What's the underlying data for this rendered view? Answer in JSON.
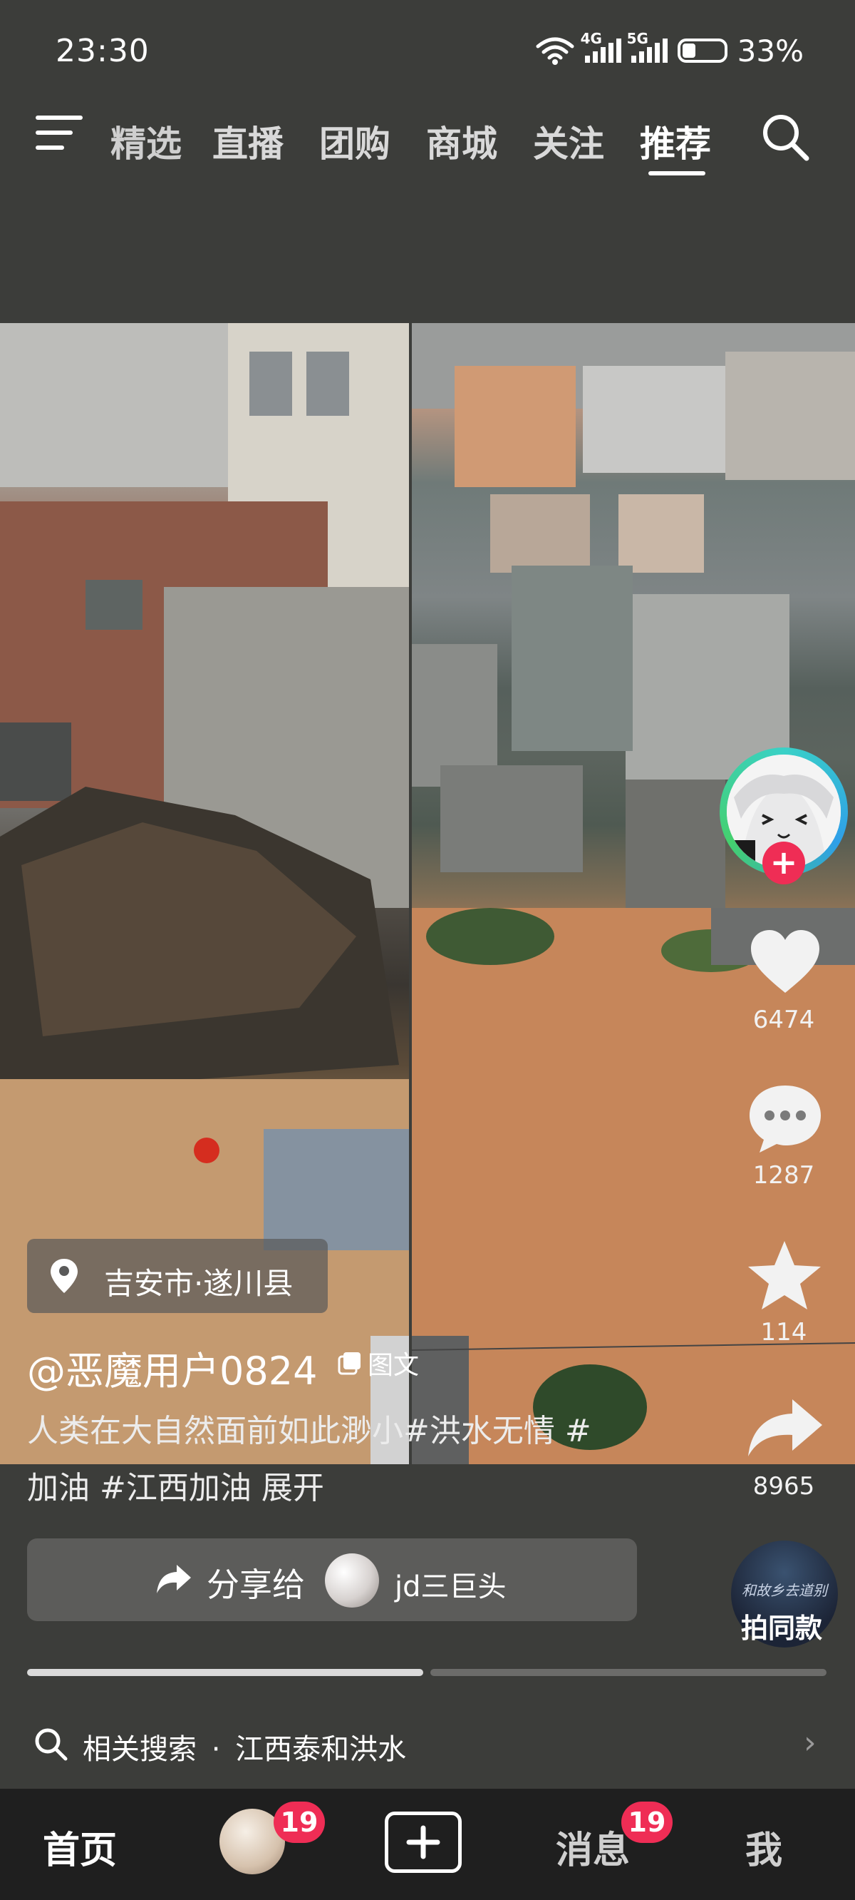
{
  "status": {
    "time": "23:30",
    "network1": "4G",
    "network2": "5G",
    "battery": "33%",
    "battery_level": 0.33
  },
  "top_tabs": [
    {
      "label": "精选"
    },
    {
      "label": "直播"
    },
    {
      "label": "团购"
    },
    {
      "label": "商城"
    },
    {
      "label": "关注"
    },
    {
      "label": "推荐"
    }
  ],
  "active_tab": "推荐",
  "post": {
    "location": "吉安市·遂川县",
    "username": "@恶魔用户0824",
    "type_tag": "图文",
    "caption_line1": "人类在大自然面前如此渺小#洪水无情 #",
    "caption_line2": "加油 #江西加油  展开"
  },
  "rail": {
    "like_count": "6474",
    "comment_count": "1287",
    "favorite_count": "114",
    "share_count": "8965",
    "follow_plus": "+"
  },
  "share_bar": {
    "label": "分享给",
    "recipient": "jd三巨头"
  },
  "same_style": {
    "label": "拍同款",
    "thumb_text": "和故乡去道别"
  },
  "image_progress": {
    "current": 1,
    "total": 2
  },
  "related_search": {
    "prefix": "相关搜索",
    "query": "江西泰和洪水",
    "separator": "·"
  },
  "bottom_nav": {
    "home": "首页",
    "messages": "消息",
    "me": "我",
    "friend_badge": "19",
    "message_badge": "19"
  },
  "icons": {
    "menu": "menu-icon",
    "search": "search-icon",
    "location": "location-pin-icon",
    "like": "heart-icon",
    "comment": "comment-icon",
    "favorite": "star-icon",
    "share": "share-icon",
    "create": "plus-icon"
  },
  "colors": {
    "accent_red": "#ef2d55",
    "background": "#3c3d3a"
  }
}
